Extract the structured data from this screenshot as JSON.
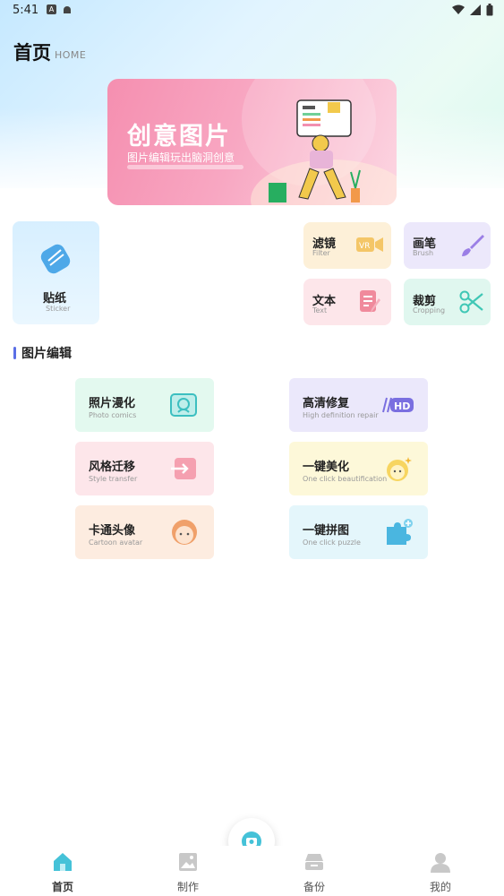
{
  "status_bar": {
    "time": "5:41"
  },
  "header": {
    "title": "首页",
    "subtitle": "HOME"
  },
  "banner": {
    "title": "创意图片",
    "subtitle": "图片编辑玩出脑洞创意"
  },
  "features": {
    "sticker": {
      "title": "贴纸",
      "en": "Sticker"
    },
    "filter": {
      "title": "滤镜",
      "en": "Filter"
    },
    "brush": {
      "title": "画笔",
      "en": "Brush"
    },
    "text": {
      "title": "文本",
      "en": "Text"
    },
    "crop": {
      "title": "裁剪",
      "en": "Cropping"
    }
  },
  "section": {
    "title": "图片编辑"
  },
  "tools": [
    {
      "title": "照片漫化",
      "en": "Photo comics"
    },
    {
      "title": "高清修复",
      "en": "High definition repair"
    },
    {
      "title": "风格迁移",
      "en": "Style transfer"
    },
    {
      "title": "一键美化",
      "en": "One click beautification"
    },
    {
      "title": "卡通头像",
      "en": "Cartoon avatar"
    },
    {
      "title": "一键拼图",
      "en": "One click puzzle"
    }
  ],
  "nav": [
    {
      "label": "首页",
      "icon": "home-icon"
    },
    {
      "label": "制作",
      "icon": "image-icon"
    },
    {
      "label": "备份",
      "icon": "backup-icon"
    },
    {
      "label": "我的",
      "icon": "user-icon"
    }
  ],
  "colors": {
    "accent": "#5b6fe6",
    "active_nav": "#45c2d8"
  }
}
